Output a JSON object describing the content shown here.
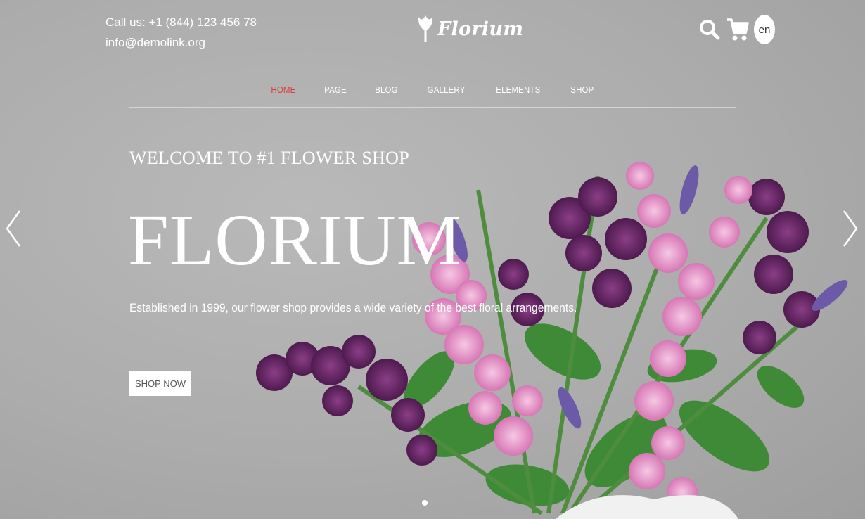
{
  "header": {
    "phone": "Call us: +1 (844) 123 456 78",
    "email": "info@demolink.org",
    "logo_text": "Florium",
    "lang": "en"
  },
  "nav": {
    "items": [
      {
        "label": "HOME",
        "active": true
      },
      {
        "label": "PAGE",
        "active": false
      },
      {
        "label": "BLOG",
        "active": false
      },
      {
        "label": "GALLERY",
        "active": false
      },
      {
        "label": "ELEMENTS",
        "active": false
      },
      {
        "label": "SHOP",
        "active": false
      }
    ]
  },
  "hero": {
    "subtitle": "WELCOME TO #1 FLOWER SHOP",
    "headline": "FLORIUM",
    "description": "Established in 1999, our flower shop provides a wide variety of the best floral arrangements.",
    "button_label": "SHOP NOW"
  },
  "icons": {
    "search": "search-icon",
    "cart": "cart-icon",
    "prev": "chevron-left-icon",
    "next": "chevron-right-icon"
  },
  "colors": {
    "accent": "#e03a3a",
    "text": "#ffffff",
    "background": "#acacac"
  }
}
